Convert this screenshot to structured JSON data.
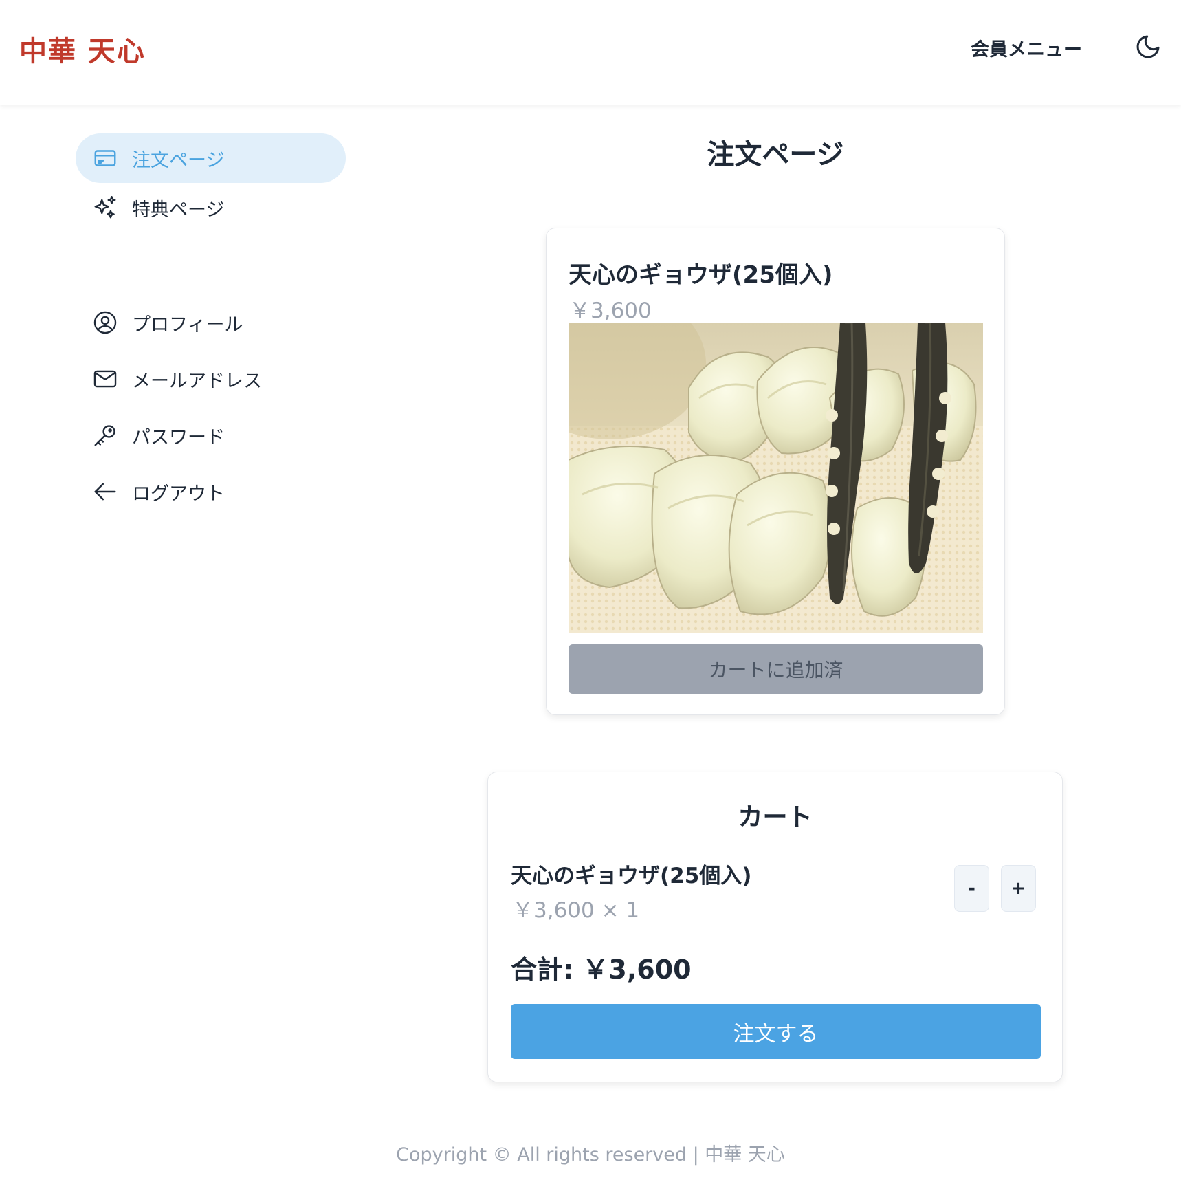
{
  "header": {
    "logo_text": "中華 天心",
    "member_menu_label": "会員メニュー",
    "theme_icon": "moon-icon",
    "brand_color": "#c0392b"
  },
  "sidebar": {
    "items": [
      {
        "label": "注文ページ",
        "icon": "credit-card-icon",
        "active": true
      },
      {
        "label": "特典ページ",
        "icon": "sparkles-icon",
        "active": false
      }
    ],
    "account_items": [
      {
        "label": "プロフィール",
        "icon": "user-circle-icon"
      },
      {
        "label": "メールアドレス",
        "icon": "envelope-icon"
      },
      {
        "label": "パスワード",
        "icon": "key-icon"
      },
      {
        "label": "ログアウト",
        "icon": "arrow-left-icon"
      }
    ],
    "active_color": "#4aa3df"
  },
  "main": {
    "title": "注文ページ",
    "product": {
      "name": "天心のギョウザ(25個入)",
      "price": "￥3,600",
      "button_label": "カートに追加済"
    },
    "cart": {
      "title": "カート",
      "items": [
        {
          "name": "天心のギョウザ(25個入)",
          "price_qty": "￥3,600 × 1",
          "minus_label": "-",
          "plus_label": "+"
        }
      ],
      "total": "合計: ￥3,600",
      "order_button_label": "注文する",
      "order_button_color": "#4ba3e3"
    }
  },
  "footer": {
    "copyright": "Copyright © All rights reserved | 中華 天心"
  }
}
